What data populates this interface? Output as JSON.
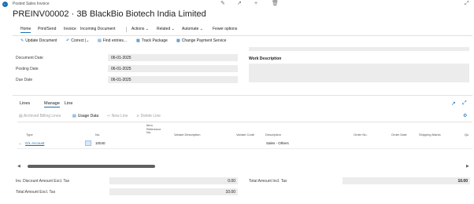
{
  "header": {
    "page_kind": "Posted Sales Invoice",
    "title": "PREINV00002 · 3B BlackBio Biotech India Limited"
  },
  "menu": {
    "items": [
      "Home",
      "Print/Send",
      "Invoice",
      "Incoming Document",
      "Actions",
      "Related",
      "Automate",
      "Fewer options"
    ]
  },
  "actions": {
    "update_document": "Update Document",
    "correct": "Correct",
    "find_entries": "Find entries...",
    "track_package": "Track Package",
    "change_payment_service": "Change Payment Service"
  },
  "fields": {
    "document_date_label": "Document Date",
    "document_date": "06-01-2025",
    "posting_date_label": "Posting Date",
    "posting_date": "06-01-2025",
    "due_date_label": "Due Date",
    "due_date": "06-01-2025",
    "work_description_label": "Work Description"
  },
  "lines": {
    "tabs": [
      "Lines",
      "Manage",
      "Line"
    ],
    "actions": {
      "archived_billing_lines": "Archived Billing Lines",
      "usage_data": "Usage Data",
      "new_line": "New Line",
      "delete_line": "Delete Line"
    },
    "columns": {
      "type": "Type",
      "no": "No.",
      "item_reference_no": "Item Reference No.",
      "variant_description": "Variant Description",
      "variant_code": "Variant Code",
      "description": "Description",
      "order_no": "Order No.",
      "order_date": "Order Date",
      "shipping_marks": "Shipping Marks",
      "qu": "Qu"
    },
    "rows": [
      {
        "type": "G/L Account",
        "no": "10040",
        "description": "Sales - Others"
      }
    ]
  },
  "totals": {
    "inv_discount_label": "Inv. Discount Amount Excl. Tax",
    "inv_discount": "0.00",
    "total_excl_label": "Total Amount Excl. Tax",
    "total_excl": "10.00",
    "total_incl_label": "Total Amount Incl. Tax",
    "total_incl": "10.00"
  },
  "colors": {
    "accent": "#1a6fb5",
    "field_bg": "#ececec"
  }
}
